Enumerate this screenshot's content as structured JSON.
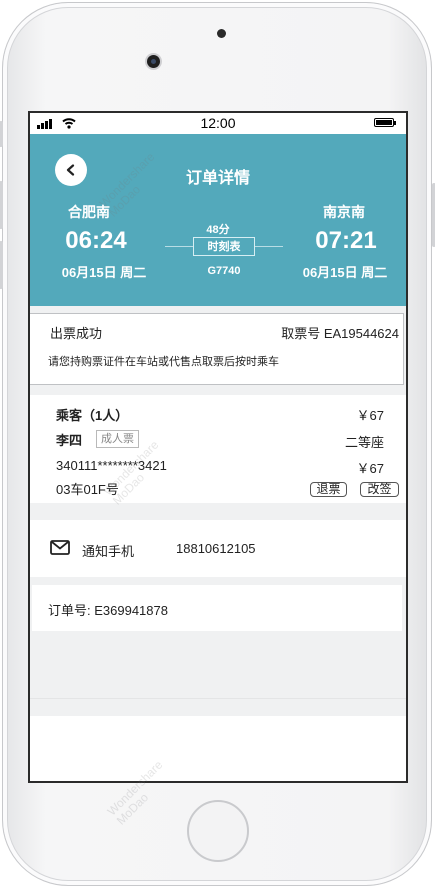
{
  "status_bar": {
    "time": "12:00"
  },
  "header": {
    "title": "订单详情",
    "departure": {
      "station": "合肥南",
      "time": "06:24",
      "date": "06月15日 周二"
    },
    "arrival": {
      "station": "南京南",
      "time": "07:21",
      "date": "06月15日 周二"
    },
    "duration": "48分",
    "timetable_label": "时刻表",
    "train_number": "G7740"
  },
  "ticket_status": {
    "status": "出票成功",
    "ticket_no": "取票号 EA19544624",
    "note": "请您持购票证件在车站或代售点取票后按时乘车"
  },
  "passenger": {
    "heading": "乘客（1人）",
    "heading_price": "￥67",
    "name": "李四",
    "ticket_type": "成人票",
    "seat_class": "二等座",
    "id_number": "340111********3421",
    "price": "￥67",
    "seat": "03车01F号",
    "refund_label": "退票",
    "change_label": "改签"
  },
  "notify": {
    "label": "通知手机",
    "phone": "18810612105"
  },
  "order": {
    "label": "订单号: E369941878"
  },
  "watermark": {
    "line1": "Wondershare",
    "line2": "MoDao"
  },
  "colors": {
    "header_bg": "#53a9bb",
    "page_bg": "#f0f1f2"
  }
}
